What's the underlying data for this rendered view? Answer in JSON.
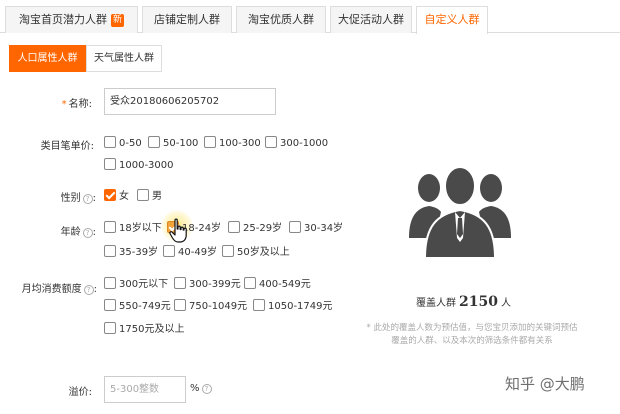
{
  "tabs": [
    {
      "label": "淘宝首页潜力人群",
      "badge": "新"
    },
    {
      "label": "店铺定制人群"
    },
    {
      "label": "淘宝优质人群"
    },
    {
      "label": "大促活动人群"
    },
    {
      "label": "自定义人群"
    }
  ],
  "subtabs": [
    "人口属性人群",
    "天气属性人群"
  ],
  "form": {
    "name_label": "名称:",
    "name_required": "*",
    "name_value": "受众20180606205702",
    "price_label": "类目笔单价:",
    "price_options": [
      "0-50",
      "50-100",
      "100-300",
      "300-1000",
      "1000-3000"
    ],
    "gender_label": "性别",
    "gender_options": [
      "女",
      "男"
    ],
    "age_label": "年龄",
    "age_options": [
      "18岁以下",
      "18-24岁",
      "25-29岁",
      "30-34岁",
      "35-39岁",
      "40-49岁",
      "50岁及以上"
    ],
    "spend_label": "月均消费额度",
    "spend_options": [
      "300元以下",
      "300-399元",
      "400-549元",
      "550-749元",
      "750-1049元",
      "1050-1749元",
      "1750元及以上"
    ],
    "premium_label": "溢价:",
    "premium_placeholder": "5-300整数",
    "premium_unit": "%",
    "help_glyph": "?"
  },
  "coverage": {
    "prefix": "覆盖人群",
    "count": "2150",
    "unit": "人",
    "notice": "* 此处的覆盖人数为预估值，与您宝贝添加的关键词预估覆盖的人群、以及本次的筛选条件都有关系"
  },
  "watermark": "知乎 @大鹏",
  "colors": {
    "accent": "#ff6600",
    "icon": "#4a4a4a"
  }
}
